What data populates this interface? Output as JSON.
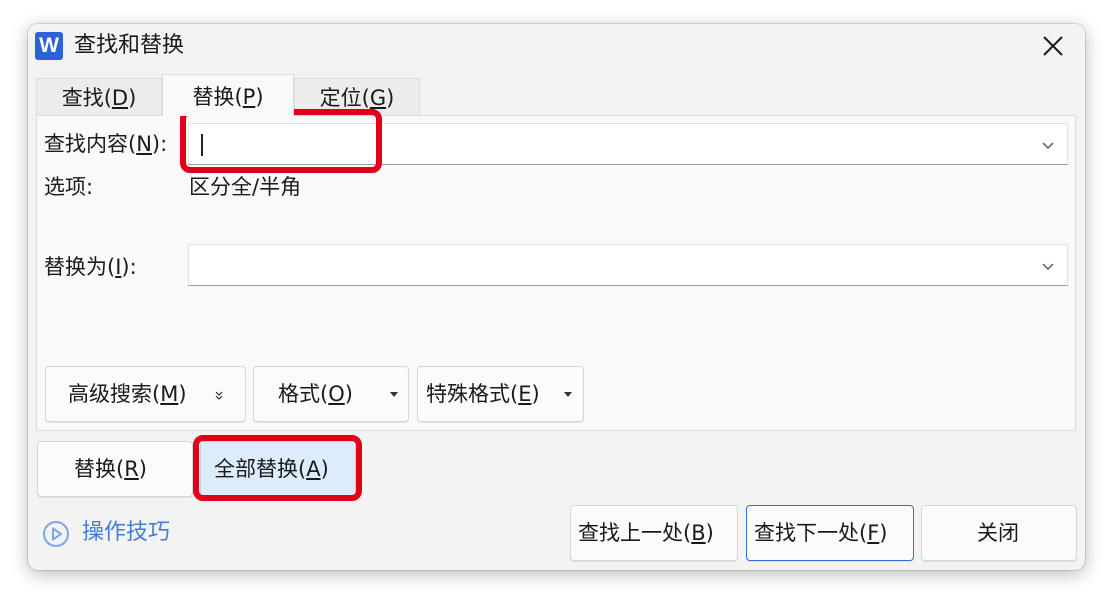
{
  "app": {
    "icon_letter": "W",
    "title": "查找和替换"
  },
  "window": {
    "close_icon": "close-icon"
  },
  "tabs": [
    {
      "label_pre": "查找(",
      "key": "D",
      "label_post": ")",
      "active": false
    },
    {
      "label_pre": "替换(",
      "key": "P",
      "label_post": ")",
      "active": true
    },
    {
      "label_pre": "定位(",
      "key": "G",
      "label_post": ")",
      "active": false
    }
  ],
  "find": {
    "label_pre": "查找内容(",
    "key": "N",
    "label_post": "):",
    "value": "",
    "dropdown_icon": "chevron-down-icon"
  },
  "options": {
    "label": "选项:",
    "value": "区分全/半角"
  },
  "replace": {
    "label_pre": "替换为(",
    "key": "I",
    "label_post": "):",
    "value": "",
    "dropdown_icon": "chevron-down-icon"
  },
  "advanced_buttons": {
    "search_pre": "高级搜索(",
    "search_key": "M",
    "search_post": ")",
    "format_pre": "格式(",
    "format_key": "O",
    "format_post": ")",
    "special_pre": "特殊格式(",
    "special_key": "E",
    "special_post": ")"
  },
  "actions": {
    "replace_pre": "替换(",
    "replace_key": "R",
    "replace_post": ")",
    "replace_all_pre": "全部替换(",
    "replace_all_key": "A",
    "replace_all_post": ")"
  },
  "footer": {
    "tips_label": "操作技巧",
    "tips_icon": "play-circle-icon",
    "find_prev_pre": "查找上一处(",
    "find_prev_key": "B",
    "find_prev_post": ")",
    "find_next_pre": "查找下一处(",
    "find_next_key": "F",
    "find_next_post": ")",
    "close_label": "关闭"
  },
  "colors": {
    "app_icon": "#2b62d9",
    "highlight": "#e0001a",
    "link": "#3f7fd9",
    "primary_border": "#2f6fd6",
    "selected_button": "#dcecfb"
  }
}
